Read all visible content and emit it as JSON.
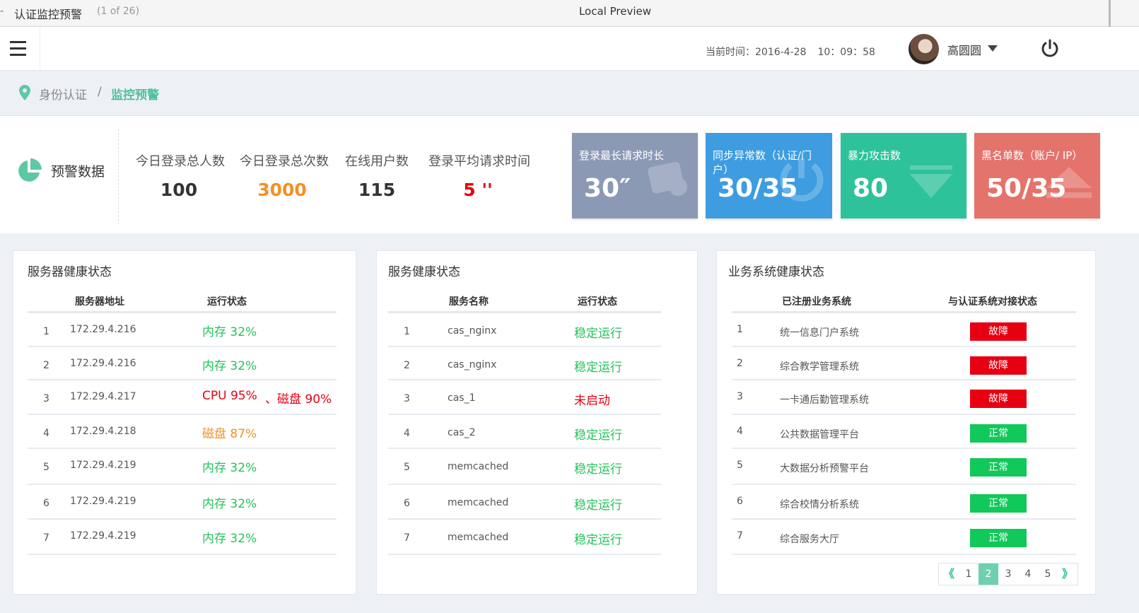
{
  "preview": {
    "dash": "-",
    "title": "认证监控预警",
    "count": "(1 of 26)",
    "center": "Local Preview"
  },
  "header": {
    "datetime_label": "当前时间：2016-4-28",
    "time": "10：09：58",
    "user_name": "高圆圆"
  },
  "breadcrumb": {
    "parent": "身份认证",
    "separator": "/",
    "current": "监控预警"
  },
  "stats": {
    "label": "预警数据",
    "metrics": [
      {
        "label": "今日登录总人数",
        "value": "100",
        "color": "#333333"
      },
      {
        "label": "今日登录总次数",
        "value": "3000",
        "color": "#f39022"
      },
      {
        "label": "在线用户数",
        "value": "115",
        "color": "#333333"
      },
      {
        "label": "登录平均请求时间",
        "value": "5 ''",
        "color": "#e60012"
      }
    ],
    "cards": [
      {
        "title": "登录最长请求时长",
        "value": "30″",
        "color": "#8c99b5",
        "icon": "clipboard-close-icon"
      },
      {
        "title": "同步异常数（认证/门户）",
        "value": "30/35",
        "color": "#3d9de0",
        "icon": "power-icon"
      },
      {
        "title": "暴力攻击数",
        "value": "80",
        "color": "#2ec29b",
        "icon": "arrow-down-icon"
      },
      {
        "title": "黑名单数（账户/ IP）",
        "value": "50/35",
        "color": "#e4736c",
        "icon": "eject-icon"
      }
    ]
  },
  "servers": {
    "title": "服务器健康状态",
    "headers": [
      "服务器地址",
      "运行状态"
    ],
    "rows": [
      {
        "no": "1",
        "addr": "172.29.4.216",
        "status": "内存 32%",
        "status2": "",
        "level": "green"
      },
      {
        "no": "2",
        "addr": "172.29.4.216",
        "status": "内存 32%",
        "status2": "",
        "level": "green"
      },
      {
        "no": "3",
        "addr": "172.29.4.217",
        "status": "CPU 95%",
        "status2": "、磁盘 90%",
        "level": "red"
      },
      {
        "no": "4",
        "addr": "172.29.4.218",
        "status": "磁盘  87%",
        "status2": "",
        "level": "orange"
      },
      {
        "no": "5",
        "addr": "172.29.4.219",
        "status": "内存 32%",
        "status2": "",
        "level": "green"
      },
      {
        "no": "6",
        "addr": "172.29.4.219",
        "status": "内存 32%",
        "status2": "",
        "level": "green"
      },
      {
        "no": "7",
        "addr": "172.29.4.219",
        "status": "内存 32%",
        "status2": "",
        "level": "green"
      }
    ]
  },
  "services": {
    "title": "服务健康状态",
    "headers": [
      "服务名称",
      "运行状态"
    ],
    "rows": [
      {
        "no": "1",
        "name": "cas_nginx",
        "status": "稳定运行",
        "level": "green"
      },
      {
        "no": "2",
        "name": "cas_nginx",
        "status": "稳定运行",
        "level": "green"
      },
      {
        "no": "3",
        "name": "cas_1",
        "status": "未启动",
        "level": "red"
      },
      {
        "no": "4",
        "name": "cas_2",
        "status": "稳定运行",
        "level": "green"
      },
      {
        "no": "5",
        "name": "memcached",
        "status": "稳定运行",
        "level": "green"
      },
      {
        "no": "6",
        "name": "memcached",
        "status": "稳定运行",
        "level": "green"
      },
      {
        "no": "7",
        "name": "memcached",
        "status": "稳定运行",
        "level": "green"
      }
    ]
  },
  "business": {
    "title": "业务系统健康状态",
    "headers": [
      "已注册业务系统",
      "与认证系统对接状态"
    ],
    "rows": [
      {
        "no": "1",
        "name": "统一信息门户系统",
        "status": "故障",
        "level": "fault"
      },
      {
        "no": "2",
        "name": "综合教学管理系统",
        "status": "故障",
        "level": "fault"
      },
      {
        "no": "3",
        "name": "一卡通后勤管理系统",
        "status": "故障",
        "level": "fault"
      },
      {
        "no": "4",
        "name": "公共数据管理平台",
        "status": "正常",
        "level": "ok"
      },
      {
        "no": "5",
        "name": "大数据分析预警平台",
        "status": "正常",
        "level": "ok"
      },
      {
        "no": "6",
        "name": "综合校情分析系统",
        "status": "正常",
        "level": "ok"
      },
      {
        "no": "7",
        "name": "综合服务大厅",
        "status": "正常",
        "level": "ok"
      }
    ],
    "pager": {
      "prev": "《",
      "next": "》",
      "pages": [
        "1",
        "2",
        "3",
        "4",
        "5"
      ],
      "current": "2"
    }
  }
}
